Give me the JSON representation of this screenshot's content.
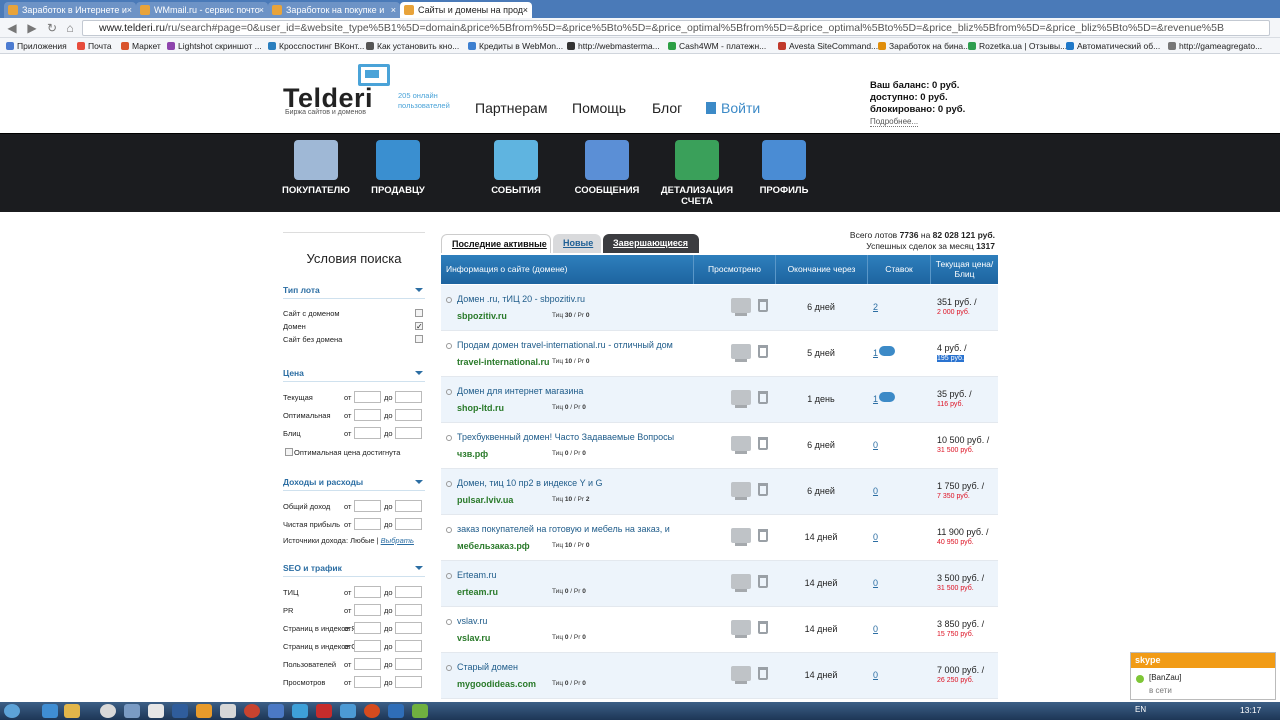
{
  "browser": {
    "tabs": [
      {
        "title": "Заработок в Интернете и",
        "active": false
      },
      {
        "title": "WMmail.ru - сервис почто",
        "active": false
      },
      {
        "title": "Заработок на покупке и",
        "active": false
      },
      {
        "title": "Сайты и домены на прод",
        "active": true
      }
    ],
    "url_host": "www.telderi.ru",
    "url_rest": "/ru/search#page=0&user_id=&website_type%5B1%5D=domain&price%5Bfrom%5D=&price%5Bto%5D=&price_optimal%5Bfrom%5D=&price_optimal%5Bto%5D=&price_bliz%5Bfrom%5D=&price_bliz%5Bto%5D=&revenue%5B",
    "bookmarks": [
      "Приложения",
      "Почта",
      "Маркет",
      "Lightshot скриншот ...",
      "Кросспостинг ВКонт...",
      "Как установить кно...",
      "Кредиты в WebMon...",
      "http://webmasterma...",
      "Cash4WM - платежн...",
      "Avesta SiteCommand...",
      "Заработок на бина...",
      "Rozetka.ua | Отзывы...",
      "Автоматический об...",
      "http://gameagregato..."
    ]
  },
  "header": {
    "logo": "Telderi",
    "logo_sub": "Биржа сайтов и доменов",
    "online": "205 онлайн пользователей",
    "nav": [
      "Партнерам",
      "Помощь",
      "Блог"
    ],
    "login": "Войти",
    "balance": {
      "line1": "Ваш баланс: 0 руб.",
      "line2": "доступно: 0 руб.",
      "line3": "блокировано: 0 руб.",
      "more": "Подробнее..."
    }
  },
  "darknav": [
    {
      "label": "ПОКУПАТЕЛЮ",
      "icon": "magnifier-doc-icon"
    },
    {
      "label": "ПРОДАВЦУ",
      "icon": "folder-icon"
    },
    {
      "label": "СОБЫТИЯ",
      "icon": "book-icon"
    },
    {
      "label": "СООБЩЕНИЯ",
      "icon": "messages-icon"
    },
    {
      "label": "ДЕТАЛИЗАЦИЯ СЧЕТА",
      "icon": "wallet-icon"
    },
    {
      "label": "ПРОФИЛЬ",
      "icon": "profile-icon"
    }
  ],
  "sidebar": {
    "title": "Условия поиска",
    "lot_type": {
      "heading": "Тип лота",
      "options": [
        {
          "label": "Сайт с доменом",
          "checked": false
        },
        {
          "label": "Домен",
          "checked": true
        },
        {
          "label": "Сайт без домена",
          "checked": false
        }
      ]
    },
    "price": {
      "heading": "Цена",
      "rows": [
        "Текущая",
        "Оптимальная",
        "Блиц"
      ],
      "optimal_reached": "Оптимальная цена достигнута"
    },
    "income": {
      "heading": "Доходы и расходы",
      "rows": [
        "Общий доход",
        "Чистая прибыль"
      ],
      "sources_label": "Источники дохода: Любые |",
      "sources_link": "Выбрать"
    },
    "seo": {
      "heading": "SEO и трафик",
      "rows": [
        "ТИЦ",
        "PR",
        "Страниц в индексе Яндекса",
        "Страниц в индексе Google",
        "Пользователей",
        "Просмотров"
      ]
    },
    "from": "от",
    "to": "до"
  },
  "list_tabs": [
    "Последние активные",
    "Новые",
    "Завершающиеся"
  ],
  "totals": {
    "line1_pre": "Всего лотов",
    "lots": "7736",
    "line1_mid": "на",
    "sum": "82 028 121 руб.",
    "line2_pre": "Успешных сделок за месяц",
    "deals": "1317"
  },
  "table": {
    "headers": [
      "Информация о сайте (домене)",
      "Просмотрено",
      "Окончание через",
      "Ставок",
      "Текущая цена/Блиц"
    ],
    "rows": [
      {
        "desc": "Домен .ru, тИЦ 20 - sbpozitiv.ru",
        "domain": "sbpozitiv.ru",
        "tic": "30",
        "pr": "0",
        "ends": "6 дней",
        "bids": "2",
        "bubble": false,
        "price": "351 руб.  /",
        "blitz": "2 000 руб.",
        "sel": false
      },
      {
        "desc": "Продам домен travel-international.ru - отличный дом",
        "domain": "travel-international.ru",
        "tic": "10",
        "pr": "0",
        "ends": "5 дней",
        "bids": "1",
        "bubble": true,
        "price": "4 руб.  /",
        "blitz": "195 руб.",
        "sel": true
      },
      {
        "desc": "Домен для интернет магазина",
        "domain": "shop-ltd.ru",
        "tic": "0",
        "pr": "0",
        "ends": "1 день",
        "bids": "1",
        "bubble": true,
        "price": "35 руб.  /",
        "blitz": "116 руб.",
        "sel": false
      },
      {
        "desc": "Трехбуквенный домен! Часто Задаваемые Вопросы",
        "domain": "чзв.рф",
        "tic": "0",
        "pr": "0",
        "ends": "6 дней",
        "bids": "0",
        "bubble": false,
        "price": "10 500 руб.  /",
        "blitz": "31 500 руб.",
        "sel": false
      },
      {
        "desc": "Домен, тиц 10 пр2 в индексе Y и G",
        "domain": "pulsar.lviv.ua",
        "tic": "10",
        "pr": "2",
        "ends": "6 дней",
        "bids": "0",
        "bubble": false,
        "price": "1 750 руб.  /",
        "blitz": "7 350 руб.",
        "sel": false
      },
      {
        "desc": "заказ покупателей на готовую и мебель на заказ, и",
        "domain": "мебельзаказ.рф",
        "tic": "10",
        "pr": "0",
        "ends": "14 дней",
        "bids": "0",
        "bubble": false,
        "price": "11 900 руб.  /",
        "blitz": "40 950 руб.",
        "sel": false
      },
      {
        "desc": "Erteam.ru",
        "domain": "erteam.ru",
        "tic": "0",
        "pr": "0",
        "ends": "14 дней",
        "bids": "0",
        "bubble": false,
        "price": "3 500 руб.  /",
        "blitz": "31 500 руб.",
        "sel": false
      },
      {
        "desc": "vslav.ru",
        "domain": "vslav.ru",
        "tic": "0",
        "pr": "0",
        "ends": "14 дней",
        "bids": "0",
        "bubble": false,
        "price": "3 850 руб.  /",
        "blitz": "15 750 руб.",
        "sel": false
      },
      {
        "desc": "Старый домен",
        "domain": "mygoodideas.com",
        "tic": "0",
        "pr": "0",
        "ends": "14 дней",
        "bids": "0",
        "bubble": false,
        "price": "7 000 руб.  /",
        "blitz": "26 250 руб.",
        "sel": false
      }
    ],
    "tic_label": "Тиц",
    "pr_label": "/ Pr"
  },
  "skype": {
    "brand": "skype",
    "name": "[BanZau]",
    "status": "в сети"
  },
  "taskbar": {
    "lang": "EN",
    "time": "13:17"
  },
  "colors": {
    "accent": "#1d64a0",
    "link": "#2c6ea3",
    "domain": "#2a7a2a",
    "blitz": "#d12222",
    "darknav": "#1b1c1f"
  }
}
